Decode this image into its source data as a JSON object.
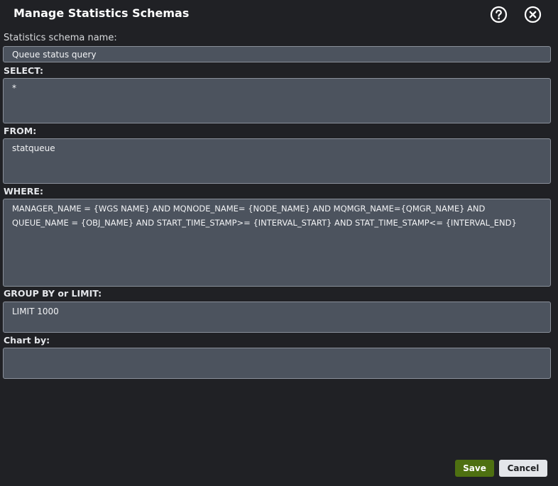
{
  "dialog": {
    "title": "Manage Statistics Schemas",
    "help_icon": "help-circle-icon",
    "close_icon": "close-circle-icon"
  },
  "form": {
    "schema_name_label": "Statistics schema name:",
    "schema_name_value": "Queue status query",
    "select_label": "SELECT:",
    "select_value": "*",
    "from_label": "FROM:",
    "from_value": "statqueue",
    "where_label": "WHERE:",
    "where_value": "MANAGER_NAME = {WGS NAME} AND MQNODE_NAME= {NODE_NAME} AND MQMGR_NAME={QMGR_NAME} AND QUEUE_NAME = {OBJ_NAME} AND START_TIME_STAMP>= {INTERVAL_START} AND STAT_TIME_STAMP<= {INTERVAL_END}",
    "group_label": "GROUP BY or LIMIT:",
    "group_value": "LIMIT 1000",
    "chart_label": "Chart by:",
    "chart_value": ""
  },
  "buttons": {
    "save_label": "Save",
    "cancel_label": "Cancel"
  },
  "colors": {
    "background": "#202125",
    "field_bg": "#4c535e",
    "save_bg": "#4e7011",
    "cancel_bg": "#e4e6ea"
  }
}
